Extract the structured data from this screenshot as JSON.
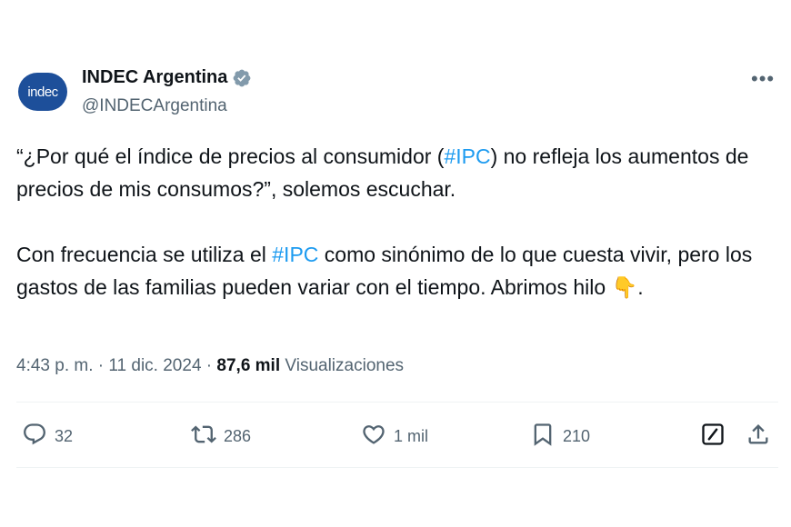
{
  "author": {
    "avatar_text": "indec",
    "name": "INDEC Argentina",
    "handle": "@INDECArgentina"
  },
  "tweet": {
    "p1": {
      "before": "“¿Por qué el índice de precios al consumidor (",
      "hashtag": "#IPC",
      "after": ") no refleja los aumentos de precios de mis consumos?”, solemos escuchar."
    },
    "p2": {
      "before": "Con frecuencia se utiliza el ",
      "hashtag": "#IPC",
      "after": " como sinónimo de lo que cuesta vivir, pero los gastos de las familias pueden variar con el tiempo. Abrimos hilo ",
      "emoji": "👇",
      "end": "."
    }
  },
  "meta": {
    "time": "4:43 p. m.",
    "separator": " · ",
    "date": "11 dic. 2024",
    "views_count": "87,6 mil",
    "views_label": "Visualizaciones"
  },
  "actions": {
    "replies": "32",
    "reposts": "286",
    "likes": "1 mil",
    "bookmarks": "210"
  },
  "colors": {
    "text": "#0f1419",
    "secondary": "#536471",
    "link": "#1d9bf0",
    "verified": "#829aab",
    "avatar_bg": "#1d4f9a"
  }
}
